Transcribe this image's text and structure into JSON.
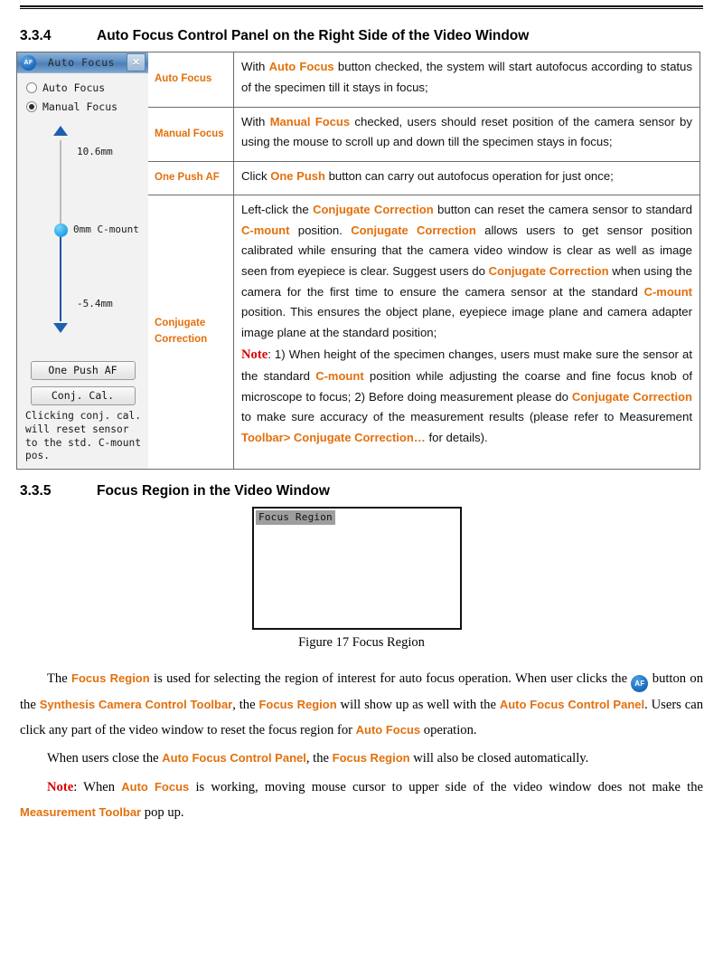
{
  "document": {
    "sections": [
      {
        "number": "3.3.4",
        "title": "Auto Focus Control Panel on the Right Side of the Video Window"
      },
      {
        "number": "3.3.5",
        "title": "Focus Region in the Video Window"
      }
    ]
  },
  "colors": {
    "accent_orange": "#e2700c",
    "note_red": "#d80000",
    "panel_background": "#f2f2f2",
    "titlebar_blue": "#4b7fb8",
    "slider_blue": "#2750a8",
    "knob_blue": "#23a7e8",
    "tag_gray": "#9e9e9e"
  },
  "af_panel": {
    "badge_icon_label": "AF",
    "title": "Auto Focus",
    "close_label": "×",
    "radios": [
      {
        "label": "Auto Focus",
        "checked": false
      },
      {
        "label": "Manual Focus",
        "checked": true
      }
    ],
    "slider": {
      "top_value": "10.6mm",
      "mid_value": "0mm C-mount",
      "bottom_value": "-5.4mm"
    },
    "buttons": [
      {
        "label": "One Push AF"
      },
      {
        "label": "Conj. Cal."
      }
    ],
    "hint": "Clicking conj. cal. will reset sensor to the std. C-mount pos."
  },
  "table": {
    "rows": [
      {
        "label": "Auto Focus",
        "desc_parts": [
          {
            "t": "With ",
            "s": "plain"
          },
          {
            "t": "Auto Focus",
            "s": "orange"
          },
          {
            "t": " button checked, the system will start autofocus according to status of the specimen till it stays in focus;",
            "s": "plain"
          }
        ]
      },
      {
        "label": "Manual Focus",
        "desc_parts": [
          {
            "t": "With ",
            "s": "plain"
          },
          {
            "t": "Manual Focus",
            "s": "orange"
          },
          {
            "t": " checked, users should reset position of the camera sensor by using the mouse to scroll up and down till the specimen stays in focus;",
            "s": "plain"
          }
        ]
      },
      {
        "label": "One Push AF",
        "desc_parts": [
          {
            "t": "Click ",
            "s": "plain"
          },
          {
            "t": "One Push",
            "s": "orange"
          },
          {
            "t": " button can carry out autofocus operation for just once;",
            "s": "plain"
          }
        ]
      },
      {
        "label": "Conjugate Correction",
        "desc_parts": [
          {
            "t": "Left-click the ",
            "s": "plain"
          },
          {
            "t": "Conjugate Correction",
            "s": "orange"
          },
          {
            "t": " button can reset the camera sensor to standard ",
            "s": "plain"
          },
          {
            "t": "C-mount",
            "s": "orange"
          },
          {
            "t": " position. ",
            "s": "plain"
          },
          {
            "t": "Conjugate Correction",
            "s": "orange"
          },
          {
            "t": " allows users to get sensor position calibrated while ensuring that the camera video window is clear as well as image seen from eyepiece is clear. Suggest users do ",
            "s": "plain"
          },
          {
            "t": "Conjugate Correction",
            "s": "orange"
          },
          {
            "t": " when using the camera for the first time to ensure the camera sensor at the standard ",
            "s": "plain"
          },
          {
            "t": "C-mount",
            "s": "orange"
          },
          {
            "t": " position. This ensures the object plane, eyepiece image plane and camera adapter image plane at the standard position;",
            "s": "plain"
          },
          {
            "t": "\n",
            "s": "break"
          },
          {
            "t": "Note",
            "s": "red"
          },
          {
            "t": ": 1) When height of the specimen changes, users must make sure the sensor at the standard ",
            "s": "plain"
          },
          {
            "t": "C-mount",
            "s": "orange"
          },
          {
            "t": " position while adjusting the coarse and fine focus knob of microscope to focus; 2) Before doing measurement please do ",
            "s": "plain"
          },
          {
            "t": "Conjugate Correction",
            "s": "orange"
          },
          {
            "t": " to make sure accuracy of the measurement results (please refer to Measurement ",
            "s": "plain"
          },
          {
            "t": "Toolbar> Conjugate Correction…",
            "s": "orange"
          },
          {
            "t": " for details).",
            "s": "plain"
          }
        ]
      }
    ]
  },
  "figure": {
    "region_tag": "Focus Region",
    "caption": "Figure 17 Focus Region"
  },
  "paragraphs": [
    {
      "id": "para-1",
      "parts": [
        {
          "t": "indent",
          "s": "indent"
        },
        {
          "t": "The ",
          "s": "plain"
        },
        {
          "t": "Focus Region",
          "s": "orange"
        },
        {
          "t": " is used for selecting the region of interest for auto focus operation. When user clicks the ",
          "s": "plain"
        },
        {
          "t": "AF",
          "s": "badge"
        },
        {
          "t": " button on the ",
          "s": "plain"
        },
        {
          "t": "Synthesis Camera Control Toolbar",
          "s": "orange"
        },
        {
          "t": ", the ",
          "s": "plain"
        },
        {
          "t": "Focus Region",
          "s": "orange"
        },
        {
          "t": " will show up as well with the ",
          "s": "plain"
        },
        {
          "t": "Auto Focus Control Panel",
          "s": "orange"
        },
        {
          "t": ". Users can click any part of the video window to reset the focus region for ",
          "s": "plain"
        },
        {
          "t": "Auto Focus",
          "s": "orange"
        },
        {
          "t": " operation.",
          "s": "plain"
        }
      ]
    },
    {
      "id": "para-2",
      "parts": [
        {
          "t": "indent",
          "s": "indent"
        },
        {
          "t": "When users close the ",
          "s": "plain"
        },
        {
          "t": "Auto Focus Control Panel",
          "s": "orange"
        },
        {
          "t": ", the ",
          "s": "plain"
        },
        {
          "t": "Focus Region",
          "s": "orange"
        },
        {
          "t": " will also be closed automatically.",
          "s": "plain"
        }
      ]
    },
    {
      "id": "para-3",
      "parts": [
        {
          "t": "indent",
          "s": "indent"
        },
        {
          "t": "Note",
          "s": "red"
        },
        {
          "t": ": When ",
          "s": "plain"
        },
        {
          "t": "Auto Focus",
          "s": "orange"
        },
        {
          "t": " is working, moving mouse cursor to upper side of the video window does not make the ",
          "s": "plain"
        },
        {
          "t": "Measurement Toolbar",
          "s": "orange"
        },
        {
          "t": " pop up.",
          "s": "plain"
        }
      ]
    }
  ]
}
